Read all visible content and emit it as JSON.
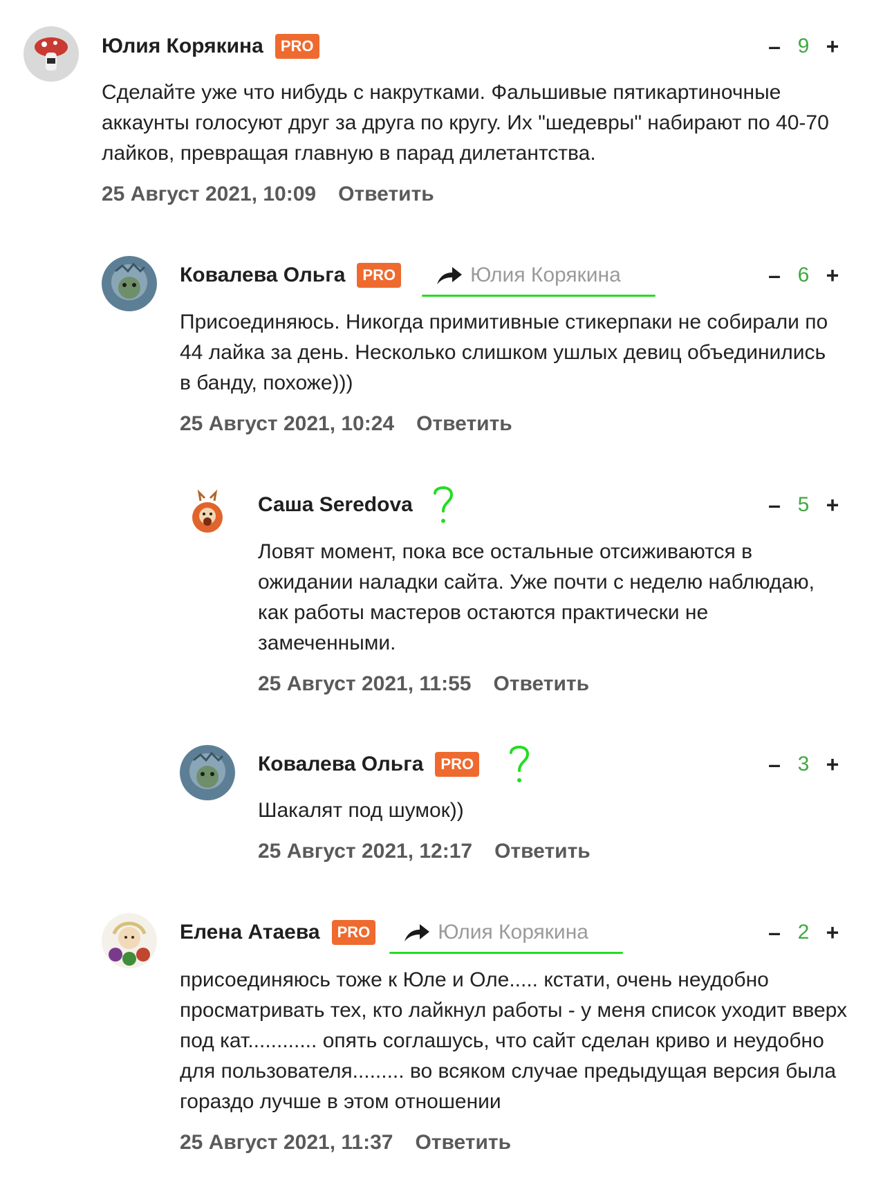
{
  "reply_label": "Ответить",
  "pro_label": "PRO",
  "comments": [
    {
      "author": "Юлия Корякина",
      "score": "9",
      "text": "Сделайте уже что нибудь с накрутками. Фальшивые пятикартиночные аккаунты голосуют друг за друга по кругу. Их \"шедевры\" набирают по 40-70 лайков, превращая главную в парад дилетантства.",
      "date": "25 Август 2021, 10:09"
    },
    {
      "author": "Ковалева Ольга",
      "reply_to": "Юлия Корякина",
      "score": "6",
      "text": "Присоединяюсь. Никогда примитивные стикерпаки не собирали по 44 лайка за день. Несколько слишком ушлых девиц объединились в банду, похоже)))",
      "date": "25 Август 2021, 10:24"
    },
    {
      "author": "Саша Seredova",
      "score": "5",
      "text": "Ловят момент, пока все остальные отсиживаются в ожидании наладки сайта. Уже почти с неделю наблюдаю, как работы мастеров остаются практически не замеченными.",
      "date": "25 Август 2021, 11:55"
    },
    {
      "author": "Ковалева Ольга",
      "score": "3",
      "text": "Шакалят под шумок))",
      "date": "25 Август 2021, 12:17"
    },
    {
      "author": "Елена Атаева",
      "reply_to": "Юлия Корякина",
      "score": "2",
      "text": "присоединяюсь тоже к Юле и Оле..... кстати, очень неудобно просматривать тех, кто лайкнул работы - у меня список уходит вверх под кат............ опять соглашусь, что сайт сделан криво и неудобно для пользователя......... во всяком случае предыдущая версия была гораздо лучше в этом отношении",
      "date": "25 Август 2021, 11:37"
    }
  ],
  "colors": {
    "pro_badge": "#ee6a2f",
    "score": "#3fa93f",
    "annotation_green": "#22dd22",
    "reply_to_text": "#9a9a9a"
  }
}
